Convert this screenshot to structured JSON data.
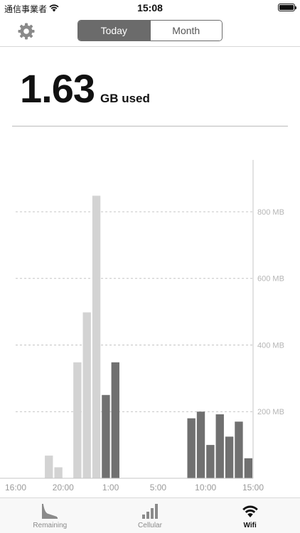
{
  "status_bar": {
    "carrier": "通信事業者",
    "time": "15:08",
    "wifi_icon": "wifi-icon",
    "battery_icon": "battery-icon",
    "battery_level": 1.0
  },
  "nav": {
    "settings_icon": "gear-icon",
    "segments": [
      {
        "label": "Today",
        "active": true
      },
      {
        "label": "Month",
        "active": false
      }
    ]
  },
  "usage": {
    "value": "1.63",
    "unit_label": "GB used"
  },
  "chart_data": {
    "type": "bar",
    "y_axis": {
      "unit": "MB",
      "position": "right",
      "ylim": [
        0,
        930
      ],
      "ticks": [
        "800 MB",
        "600 MB",
        "400 MB",
        "200 MB"
      ],
      "tick_values": [
        800,
        600,
        400,
        200
      ]
    },
    "x_axis": {
      "ticks": [
        "16:00",
        "20:00",
        "1:00",
        "5:00",
        "10:00",
        "15:00"
      ],
      "tick_slots": [
        0,
        5,
        10,
        15,
        20,
        25
      ]
    },
    "grid": "dashed-horizontal",
    "slot_count": 25,
    "colors": {
      "earlier": "#d3d3d3",
      "recent": "#707070"
    },
    "bars": [
      {
        "slot": 3,
        "value": 68,
        "shade": "earlier"
      },
      {
        "slot": 4,
        "value": 33,
        "shade": "earlier"
      },
      {
        "slot": 6,
        "value": 348,
        "shade": "earlier"
      },
      {
        "slot": 7,
        "value": 498,
        "shade": "earlier"
      },
      {
        "slot": 8,
        "value": 848,
        "shade": "earlier"
      },
      {
        "slot": 9,
        "value": 250,
        "shade": "recent"
      },
      {
        "slot": 10,
        "value": 348,
        "shade": "recent"
      },
      {
        "slot": 18,
        "value": 180,
        "shade": "recent"
      },
      {
        "slot": 19,
        "value": 200,
        "shade": "recent"
      },
      {
        "slot": 20,
        "value": 100,
        "shade": "recent"
      },
      {
        "slot": 21,
        "value": 192,
        "shade": "recent"
      },
      {
        "slot": 22,
        "value": 125,
        "shade": "recent"
      },
      {
        "slot": 23,
        "value": 170,
        "shade": "recent"
      },
      {
        "slot": 24,
        "value": 60,
        "shade": "recent"
      }
    ]
  },
  "tabs": [
    {
      "label": "Remaining",
      "icon": "remaining-chart-icon",
      "active": false
    },
    {
      "label": "Cellular",
      "icon": "cellular-signal-icon",
      "active": false
    },
    {
      "label": "Wifi",
      "icon": "wifi-icon",
      "active": true
    }
  ]
}
